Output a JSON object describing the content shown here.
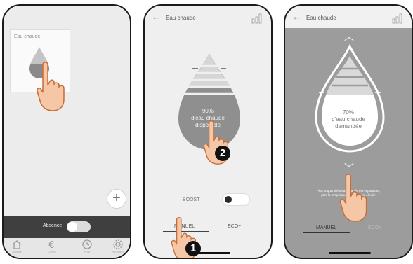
{
  "screen1": {
    "tile_label": "Eau chaude",
    "absence_label": "Absence",
    "fab_label": "+",
    "nav": [
      {
        "icon": "home-icon",
        "label": "Accueil"
      },
      {
        "icon": "euro-icon",
        "label": "Conso"
      },
      {
        "icon": "clock-icon",
        "label": "Prog"
      },
      {
        "icon": "gear-icon",
        "label": "Réglages"
      }
    ]
  },
  "screen2": {
    "title": "Eau chaude",
    "back": "←",
    "drop_percent": "90%",
    "drop_line1": "d'eau chaude",
    "drop_line2": "disponible",
    "boost_label": "BOOST",
    "tab_manual": "MANUEL",
    "tab_eco": "ECO+",
    "step_badge": "2",
    "step_badge_bottom": "1"
  },
  "screen3": {
    "title": "Eau chaude",
    "back": "←",
    "drop_percent": "70%",
    "drop_line1": "d'eau chaude",
    "drop_line2": "demandée",
    "up": "︿",
    "down": "﹀",
    "info_line1": "Plus la quantité d'eau chaude est importante,",
    "info_line2": "plus la température de l'eau est élevée",
    "tab_manual": "MANUEL",
    "tab_eco": "ECO+"
  },
  "colors": {
    "drop_fill": "#8f8f8f",
    "drop_light": "#d9d9d9",
    "phone_border": "#1b1b1b",
    "hand": "#f5c7a6",
    "hand_outline": "#c76c36"
  }
}
